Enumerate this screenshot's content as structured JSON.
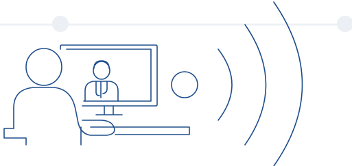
{
  "illustration": {
    "icon": "telehealth-video-call-icon",
    "colors": {
      "stroke": "#1f4e8c",
      "track_line": "#eef1f5",
      "track_dot": "#eceff3",
      "background": "#ffffff"
    }
  }
}
